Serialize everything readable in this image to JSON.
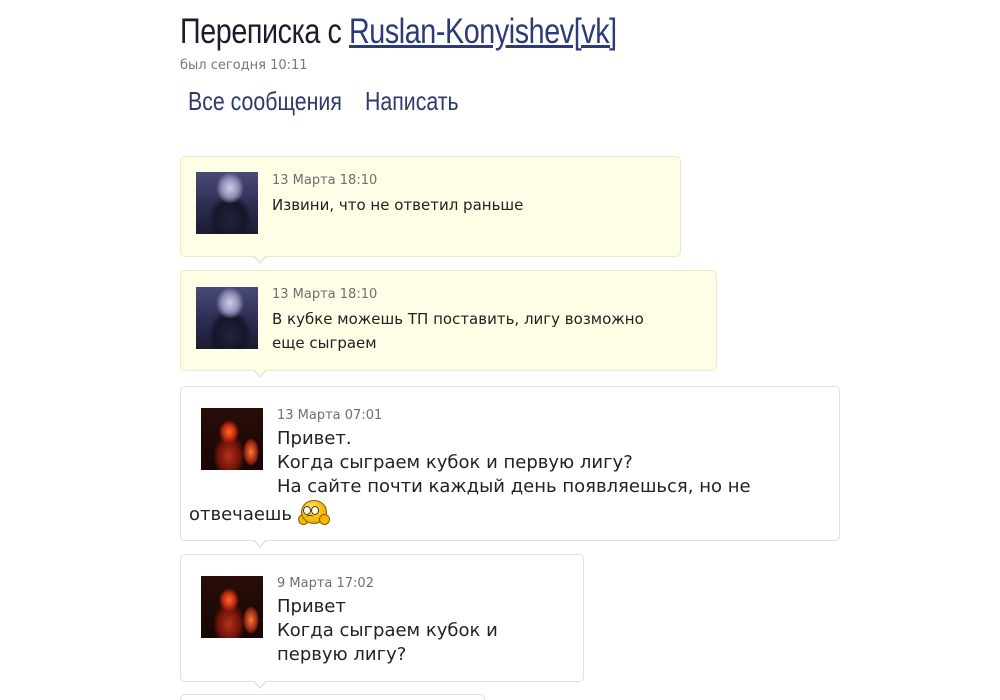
{
  "header": {
    "title_prefix": "Переписка с ",
    "title_user": "Ruslan-Konyishev[vk]",
    "last_seen": "был сегодня 10:11"
  },
  "nav": {
    "all_messages": "Все сообщения",
    "write": "Написать"
  },
  "messages": [
    {
      "date": "13 Марта 18:10",
      "lines": [
        "Извини, что не ответил раньше"
      ],
      "avatar": "user-avatar-anime"
    },
    {
      "date": "13 Марта 18:10",
      "lines": [
        "В кубке можешь ТП поставить, лигу возможно",
        "еще сыграем"
      ],
      "avatar": "user-avatar-anime"
    },
    {
      "date": "13 Марта 07:01",
      "lines": [
        "Привет.",
        "Когда сыграем кубок и первую лигу?",
        "На сайте почти каждый день появляешься, но не",
        "отвечаешь"
      ],
      "avatar": "user-avatar-red",
      "emoticon": "sad-smiley-icon"
    },
    {
      "date": "9 Марта 17:02",
      "lines": [
        "Привет",
        "Когда сыграем кубок и",
        "первую лигу?"
      ],
      "avatar": "user-avatar-red"
    }
  ],
  "colors": {
    "incoming_bg": "#fefde6",
    "outgoing_bg": "#ffffff",
    "link": "#2e3a78"
  }
}
